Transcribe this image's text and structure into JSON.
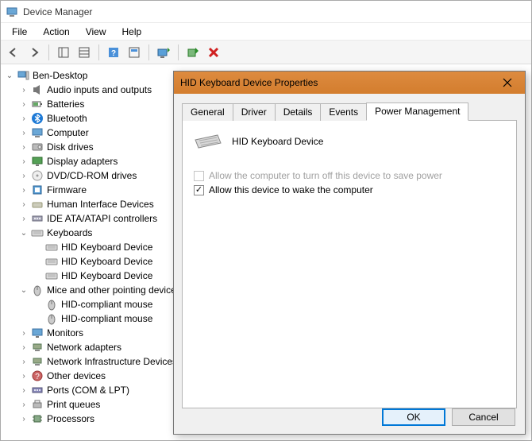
{
  "window": {
    "title": "Device Manager"
  },
  "menu": {
    "file": "File",
    "action": "Action",
    "view": "View",
    "help": "Help"
  },
  "tree": {
    "root": "Ben-Desktop",
    "nodes": [
      {
        "label": "Audio inputs and outputs",
        "icon": "speaker"
      },
      {
        "label": "Batteries",
        "icon": "battery"
      },
      {
        "label": "Bluetooth",
        "icon": "bluetooth"
      },
      {
        "label": "Computer",
        "icon": "computer"
      },
      {
        "label": "Disk drives",
        "icon": "disk"
      },
      {
        "label": "Display adapters",
        "icon": "display"
      },
      {
        "label": "DVD/CD-ROM drives",
        "icon": "disc"
      },
      {
        "label": "Firmware",
        "icon": "firmware"
      },
      {
        "label": "Human Interface Devices",
        "icon": "hid"
      },
      {
        "label": "IDE ATA/ATAPI controllers",
        "icon": "ide"
      },
      {
        "label": "Keyboards",
        "icon": "keyboard",
        "expanded": true,
        "children": [
          {
            "label": "HID Keyboard Device",
            "icon": "keyboard"
          },
          {
            "label": "HID Keyboard Device",
            "icon": "keyboard"
          },
          {
            "label": "HID Keyboard Device",
            "icon": "keyboard"
          }
        ]
      },
      {
        "label": "Mice and other pointing devices",
        "icon": "mouse",
        "expanded": true,
        "children": [
          {
            "label": "HID-compliant mouse",
            "icon": "mouse"
          },
          {
            "label": "HID-compliant mouse",
            "icon": "mouse"
          }
        ]
      },
      {
        "label": "Monitors",
        "icon": "monitor"
      },
      {
        "label": "Network adapters",
        "icon": "network"
      },
      {
        "label": "Network Infrastructure Devices",
        "icon": "network"
      },
      {
        "label": "Other devices",
        "icon": "other"
      },
      {
        "label": "Ports (COM & LPT)",
        "icon": "port"
      },
      {
        "label": "Print queues",
        "icon": "printer"
      },
      {
        "label": "Processors",
        "icon": "cpu"
      }
    ]
  },
  "dialog": {
    "title": "HID Keyboard Device Properties",
    "tabs": {
      "general": "General",
      "driver": "Driver",
      "details": "Details",
      "events": "Events",
      "power": "Power Management"
    },
    "device_name": "HID Keyboard Device",
    "chk_turnoff": "Allow the computer to turn off this device to save power",
    "chk_wake": "Allow this device to wake the computer",
    "chk_turnoff_enabled": false,
    "chk_wake_checked": true,
    "ok": "OK",
    "cancel": "Cancel"
  }
}
